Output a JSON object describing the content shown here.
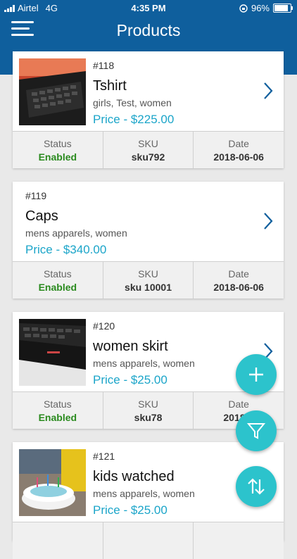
{
  "status_bar": {
    "carrier": "Airtel",
    "network": "4G",
    "time": "4:35 PM",
    "battery": "96%",
    "battery_level": 0.96
  },
  "header": {
    "title": "Products"
  },
  "labels": {
    "status": "Status",
    "sku": "SKU",
    "date": "Date"
  },
  "products": [
    {
      "id": "#118",
      "name": "Tshirt",
      "tags": "girls, Test, women",
      "price": "Price - $225.00",
      "status": "Enabled",
      "sku": "sku792",
      "date": "2018-06-06",
      "image": "laptop-keyboard"
    },
    {
      "id": "#119",
      "name": "Caps",
      "tags": "mens apparels, women",
      "price": "Price - $340.00",
      "status": "Enabled",
      "sku": "sku 10001",
      "date": "2018-06-06",
      "image": ""
    },
    {
      "id": "#120",
      "name": "women skirt",
      "tags": "mens apparels, women",
      "price": "Price - $25.00",
      "status": "Enabled",
      "sku": "sku78",
      "date": "2018-0",
      "image": "laptop-keyboard"
    },
    {
      "id": "#121",
      "name": "kids watched",
      "tags": "mens apparels, women",
      "price": "Price - $25.00",
      "image": "birthday-cake"
    }
  ],
  "fabs": {
    "add": "plus-icon",
    "filter": "filter-icon",
    "sort": "sort-icon"
  },
  "colors": {
    "header": "#0f5f9d",
    "accent": "#1ba5c9",
    "fab": "#2cc3cc",
    "enabled": "#2a8a1e"
  }
}
